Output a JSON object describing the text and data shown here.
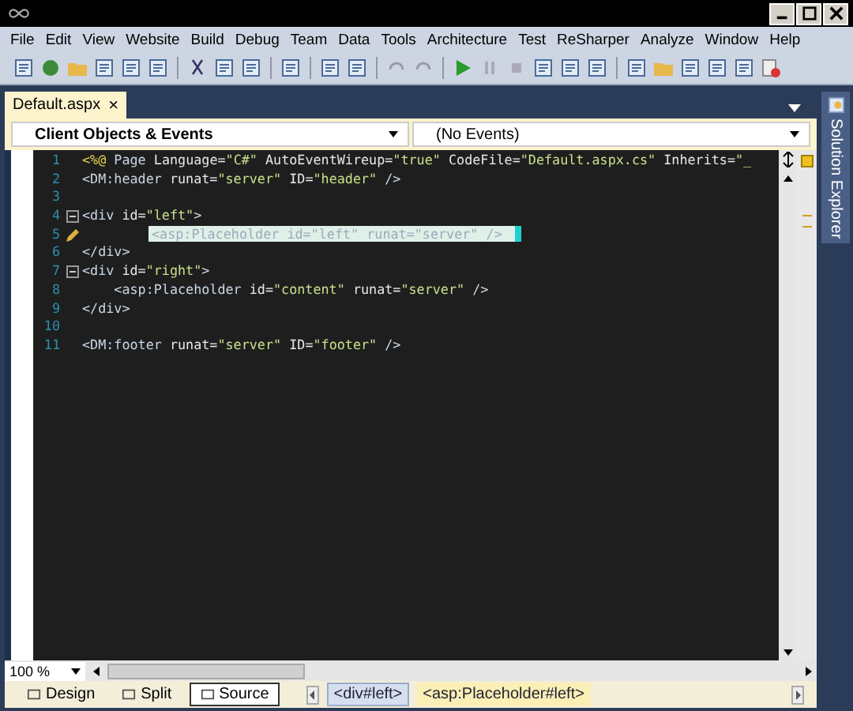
{
  "menu": [
    "File",
    "Edit",
    "View",
    "Website",
    "Build",
    "Debug",
    "Team",
    "Data",
    "Tools",
    "Architecture",
    "Test",
    "ReSharper",
    "Analyze",
    "Window",
    "Help"
  ],
  "tabs": [
    {
      "label": "Default.aspx",
      "selected": true,
      "close": "×"
    }
  ],
  "dropdowns": [
    "Client Objects & Events",
    "(No Events)"
  ],
  "side_panel": {
    "label": "Solution Explorer"
  },
  "code": [
    {
      "number": "1",
      "foldable": false,
      "edited": false,
      "tokens": [
        {
          "kind": "directive",
          "text": "<%@"
        },
        {
          "kind": "tag",
          "text": " Page"
        },
        {
          "kind": "attr",
          "text": " Language="
        },
        {
          "kind": "string",
          "text": "\"C#\""
        },
        {
          "kind": "attr",
          "text": " AutoEventWireup="
        },
        {
          "kind": "string",
          "text": "\"true\""
        },
        {
          "kind": "attr",
          "text": " CodeFile="
        },
        {
          "kind": "string",
          "text": "\"Default.aspx.cs\""
        },
        {
          "kind": "attr",
          "text": " Inherits="
        },
        {
          "kind": "string",
          "text": "\"_"
        }
      ]
    },
    {
      "number": "2",
      "foldable": false,
      "edited": false,
      "tokens": [
        {
          "kind": "tag",
          "text": "<DM:header"
        },
        {
          "kind": "attr",
          "text": " runat="
        },
        {
          "kind": "string",
          "text": "\"server\""
        },
        {
          "kind": "attr",
          "text": " ID="
        },
        {
          "kind": "string",
          "text": "\"header\""
        },
        {
          "kind": "tag",
          "text": " />"
        }
      ]
    },
    {
      "number": "3",
      "foldable": false,
      "edited": false
    },
    {
      "number": "4",
      "foldable": true,
      "edited": false,
      "tokens": [
        {
          "kind": "tag",
          "text": "<div"
        },
        {
          "kind": "attr",
          "text": " id="
        },
        {
          "kind": "string",
          "text": "\"left\""
        },
        {
          "kind": "tag",
          "text": ">"
        }
      ]
    },
    {
      "number": "5",
      "foldable": false,
      "edited": true,
      "tokens": [
        {
          "kind": "highlight",
          "text": "<asp:Placeholder id=\"left\" runat=\"server\" />"
        }
      ]
    },
    {
      "number": "6",
      "foldable": false,
      "edited": false,
      "tokens": [
        {
          "kind": "tag",
          "text": "</div>"
        }
      ]
    },
    {
      "number": "7",
      "foldable": true,
      "edited": false,
      "tokens": [
        {
          "kind": "tag",
          "text": "<div"
        },
        {
          "kind": "attr",
          "text": " id="
        },
        {
          "kind": "string",
          "text": "\"right\""
        },
        {
          "kind": "tag",
          "text": ">"
        }
      ]
    },
    {
      "number": "8",
      "foldable": false,
      "edited": false,
      "tokens": [
        {
          "kind": "tag",
          "text": "    <asp:Placeholder"
        },
        {
          "kind": "attr",
          "text": " id="
        },
        {
          "kind": "string",
          "text": "\"content\""
        },
        {
          "kind": "attr",
          "text": " runat="
        },
        {
          "kind": "string",
          "text": "\"server\""
        },
        {
          "kind": "tag",
          "text": " />"
        }
      ]
    },
    {
      "number": "9",
      "foldable": false,
      "edited": false,
      "tokens": [
        {
          "kind": "tag",
          "text": "</div>"
        }
      ]
    },
    {
      "number": "10",
      "foldable": false,
      "edited": false
    },
    {
      "number": "11",
      "foldable": false,
      "edited": false,
      "tokens": [
        {
          "kind": "tag",
          "text": "<DM:footer"
        },
        {
          "kind": "attr",
          "text": " runat="
        },
        {
          "kind": "string",
          "text": "\"server\""
        },
        {
          "kind": "attr",
          "text": " ID="
        },
        {
          "kind": "string",
          "text": "\"footer\""
        },
        {
          "kind": "tag",
          "text": " />"
        }
      ]
    }
  ],
  "zoom": "100 %",
  "views": [
    {
      "label": "Design",
      "selected": false
    },
    {
      "label": "Split",
      "selected": false
    },
    {
      "label": "Source",
      "selected": true
    }
  ],
  "breadcrumbs": [
    {
      "label": "<div#left>",
      "selected": false
    },
    {
      "label": "<asp:Placeholder#left>",
      "selected": true
    }
  ]
}
